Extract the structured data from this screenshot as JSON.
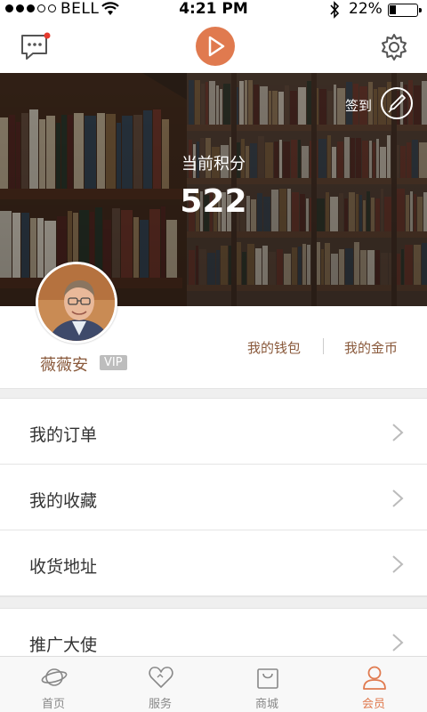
{
  "status_bar": {
    "carrier": "BELL",
    "time": "4:21 PM",
    "battery_percent": "22%",
    "battery_level": 0.22,
    "signal_bars": 3
  },
  "navbar": {
    "message_icon": "message-icon",
    "play_icon": "play-icon",
    "settings_icon": "gear-icon"
  },
  "hero": {
    "checkin_label": "签到",
    "points_label": "当前积分",
    "points_value": "522"
  },
  "profile": {
    "username": "薇薇安",
    "vip_badge": "VIP",
    "wallet_link": "我的钱包",
    "coins_link": "我的金币"
  },
  "menu": [
    {
      "label": "我的订单"
    },
    {
      "label": "我的收藏"
    },
    {
      "label": "收货地址"
    },
    {
      "label": "推广大使"
    }
  ],
  "tabs": [
    {
      "label": "首页",
      "icon": "planet-icon"
    },
    {
      "label": "服务",
      "icon": "heart-icon"
    },
    {
      "label": "商城",
      "icon": "shopping-bag-icon"
    },
    {
      "label": "会员",
      "icon": "person-icon",
      "active": true
    }
  ],
  "colors": {
    "accent": "#e07a4f",
    "link_brown": "#8a5a3c"
  }
}
